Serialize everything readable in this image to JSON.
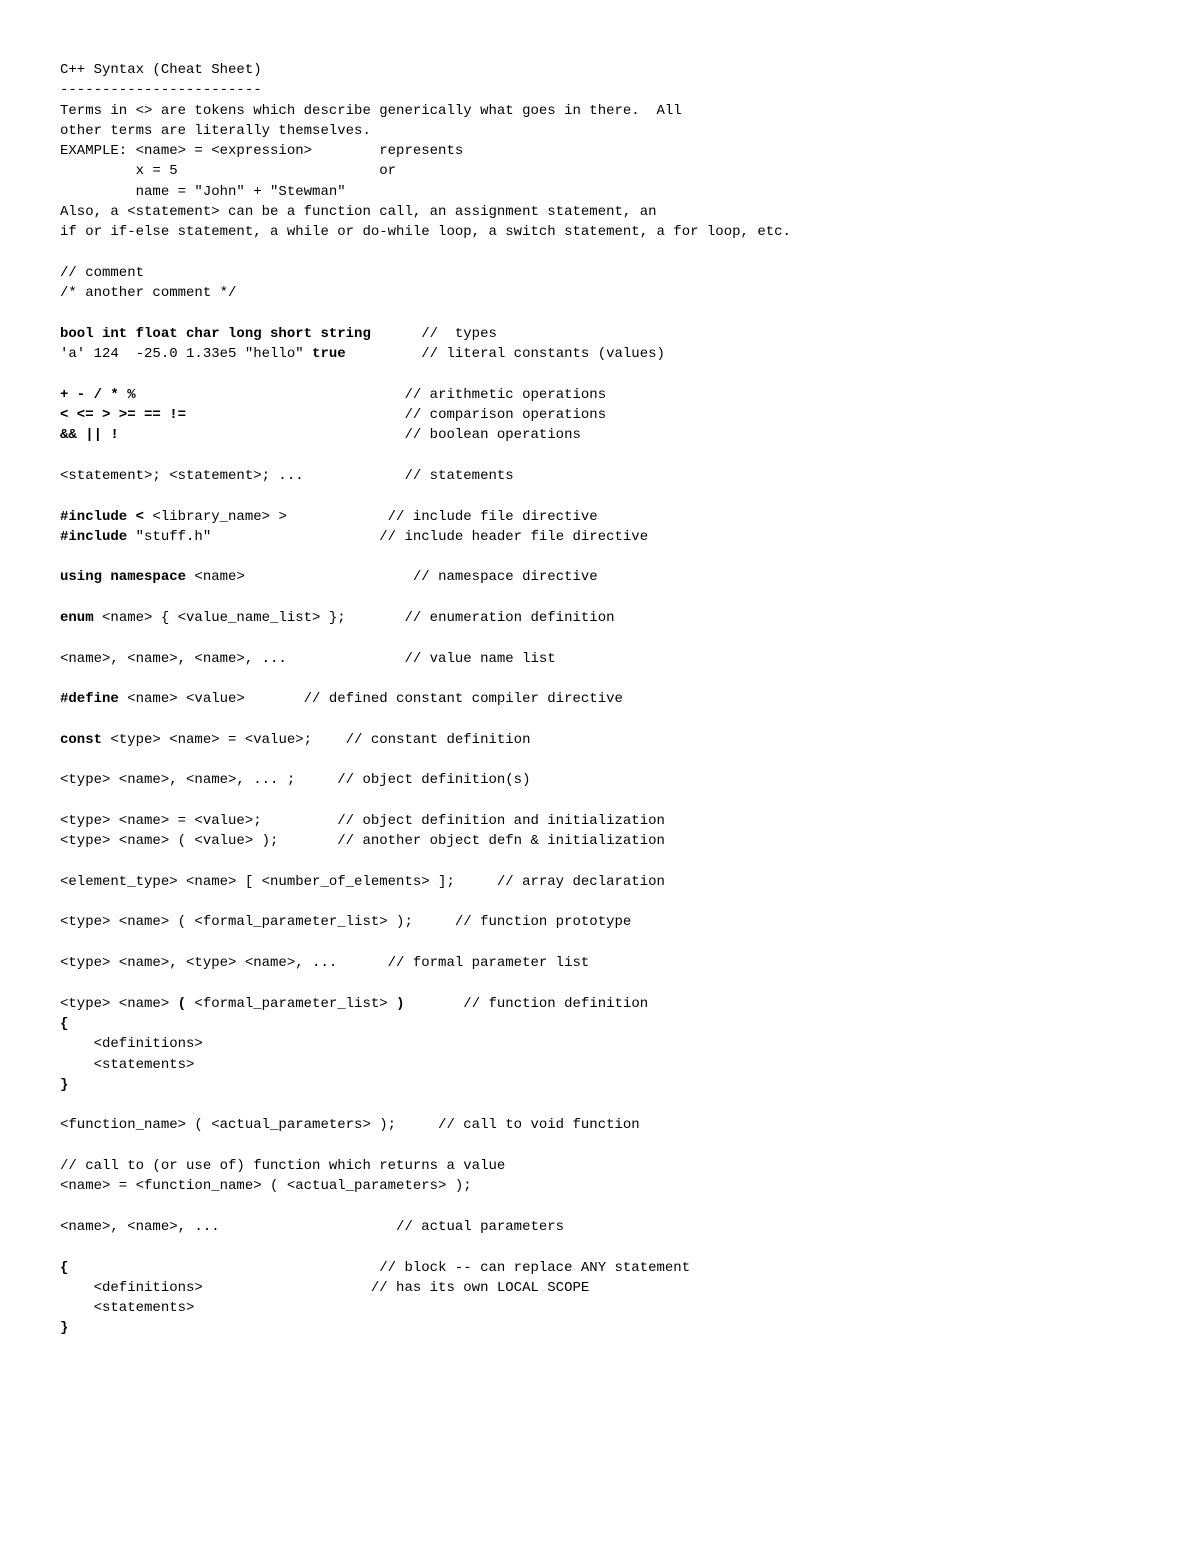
{
  "title": "C++ Syntax (Cheat Sheet)",
  "rule": "------------------------",
  "intro1": "Terms in <> are tokens which describe generically what goes in there.  All",
  "intro2": "other terms are literally themselves.",
  "example_label": "EXAMPLE: <name> = <expression>        represents",
  "example_l1": "         x = 5                        or",
  "example_l2": "         name = \"John\" + \"Stewman\"",
  "also1": "Also, a <statement> can be a function call, an assignment statement, an",
  "also2": "if or if-else statement, a while or do-while loop, a switch statement, a for loop, etc.",
  "comment1": "// comment",
  "comment2": "/* another comment */",
  "types_bold": "bool int float char long short string",
  "types_cmt": "      //  types",
  "lit_pre": "'a' 124  -25.0 1.33e5 \"hello\" ",
  "lit_bold": "true",
  "lit_cmt": "         // literal constants (values)",
  "arith_bold": "+ - / * %",
  "arith_cmt": "                                // arithmetic operations",
  "comp_bold": "< <= > >= == !=",
  "comp_cmt": "                          // comparison operations",
  "bool_bold": "&& || !",
  "bool_cmt": "                                  // boolean operations",
  "stmts": "<statement>; <statement>; ...            // statements",
  "incl1_bold": "#include <",
  "incl1_rest": " <library_name> >            // include file directive",
  "incl2_bold": "#include",
  "incl2_rest": " \"stuff.h\"                    // include header file directive",
  "using_bold": "using namespace",
  "using_rest": " <name>                    // namespace directive",
  "enum_bold": "enum",
  "enum_rest": " <name> { <value_name_list> };       // enumeration definition",
  "vnamelist": "<name>, <name>, <name>, ...              // value name list",
  "def_bold": "#define",
  "def_rest": " <name> <value>       // defined constant compiler directive",
  "const_bold": "const",
  "const_rest": " <type> <name> = <value>;    // constant definition",
  "objdef": "<type> <name>, <name>, ... ;     // object definition(s)",
  "objinit1": "<type> <name> = <value>;         // object definition and initialization",
  "objinit2": "<type> <name> ( <value> );       // another object defn & initialization",
  "arrdecl": "<element_type> <name> [ <number_of_elements> ];     // array declaration",
  "fproto": "<type> <name> ( <formal_parameter_list> );     // function prototype",
  "fparams": "<type> <name>, <type> <name>, ...      // formal parameter list",
  "fdef_head_pre": "<type> <name> ",
  "fdef_head_b1": "(",
  "fdef_head_mid": " <formal_parameter_list> ",
  "fdef_head_b2": ")",
  "fdef_head_cmt": "       // function definition",
  "brace_open": "{",
  "fdef_body1": "    <definitions>",
  "fdef_body2": "    <statements>",
  "brace_close": "}",
  "voidcall": "<function_name> ( <actual_parameters> );     // call to void function",
  "valcall_cmt": "// call to (or use of) function which returns a value",
  "valcall": "<name> = <function_name> ( <actual_parameters> );",
  "actualp": "<name>, <name>, ...                     // actual parameters",
  "block_open_cmt": "                                     // block -- can replace ANY statement",
  "block_defs": "    <definitions>                    // has its own LOCAL SCOPE",
  "block_stmts": "    <statements>"
}
